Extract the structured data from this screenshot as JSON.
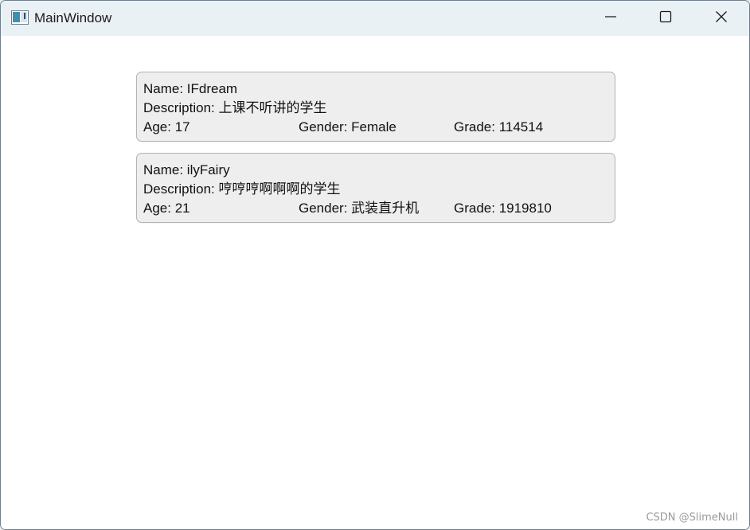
{
  "window": {
    "title": "MainWindow"
  },
  "students": [
    {
      "name": "Name: IFdream",
      "description": "Description: 上课不听讲的学生",
      "age": "Age: 17",
      "gender": "Gender: Female",
      "grade": "Grade: 114514"
    },
    {
      "name": "Name: ilyFairy",
      "description": "Description: 哼哼哼啊啊啊的学生",
      "age": "Age: 21",
      "gender": "Gender: 武装直升机",
      "grade": "Grade: 1919810"
    }
  ],
  "watermark": "CSDN @SlimeNull",
  "icons": {
    "app": "app-window-icon",
    "minimize": "minimize-icon",
    "maximize": "maximize-icon",
    "close": "close-icon"
  },
  "colors": {
    "titlebar": "#eaf1f5",
    "card_bg": "#eeeeee",
    "card_border": "#b3b3b3"
  }
}
